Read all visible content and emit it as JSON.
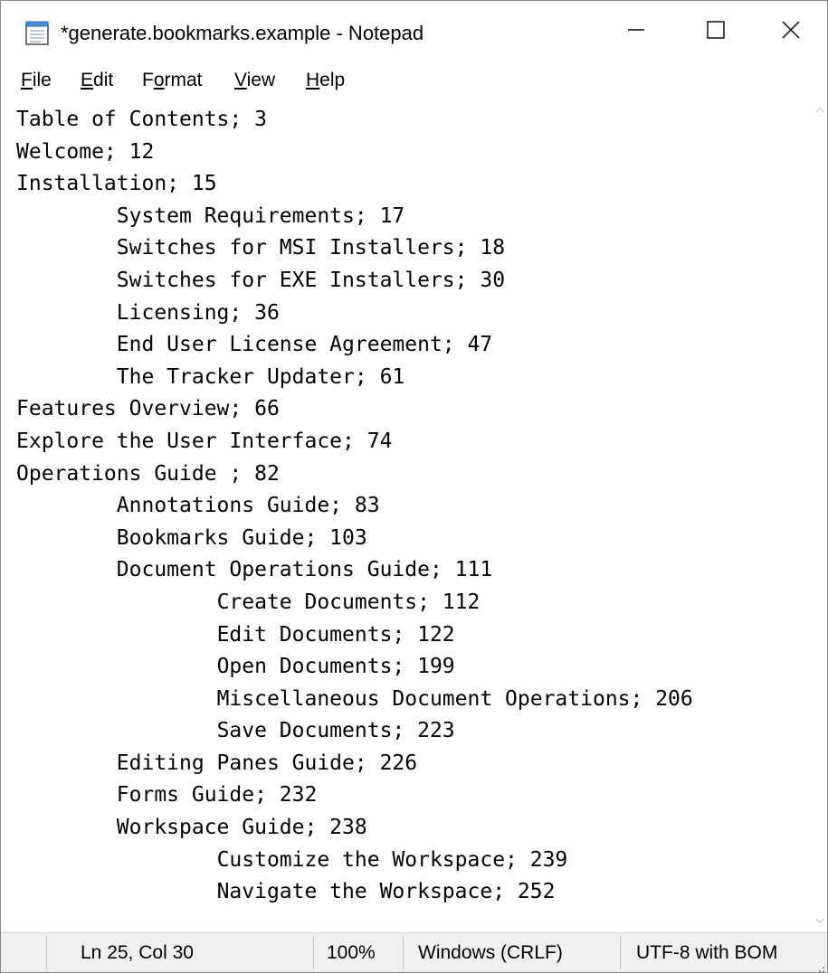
{
  "window": {
    "title": "*generate.bookmarks.example - Notepad"
  },
  "menu": {
    "items": [
      {
        "accel": "F",
        "rest": "ile"
      },
      {
        "accel": "E",
        "rest": "dit"
      },
      {
        "pre": "F",
        "accel": "o",
        "rest": "rmat"
      },
      {
        "accel": "V",
        "rest": "iew"
      },
      {
        "accel": "H",
        "rest": "elp"
      }
    ]
  },
  "editor": {
    "text": "Table of Contents; 3\nWelcome; 12\nInstallation; 15\n\tSystem Requirements; 17\n\tSwitches for MSI Installers; 18\n\tSwitches for EXE Installers; 30\n\tLicensing; 36\n\tEnd User License Agreement; 47\n\tThe Tracker Updater; 61\nFeatures Overview; 66\nExplore the User Interface; 74\nOperations Guide ; 82\n\tAnnotations Guide; 83\n\tBookmarks Guide; 103\n\tDocument Operations Guide; 111\n\t\tCreate Documents; 112\n\t\tEdit Documents; 122\n\t\tOpen Documents; 199\n\t\tMiscellaneous Document Operations; 206\n\t\tSave Documents; 223\n\tEditing Panes Guide; 226\n\tForms Guide; 232\n\tWorkspace Guide; 238\n\t\tCustomize the Workspace; 239\n\t\tNavigate the Workspace; 252"
  },
  "status": {
    "position": "Ln 25, Col 30",
    "zoom": "100%",
    "line_ending": "Windows (CRLF)",
    "encoding": "UTF-8 with BOM"
  },
  "colors": {
    "status_bg": "#f0f0f0",
    "icon_blue": "#3c8fd8"
  },
  "icons": {
    "app": "notepad-icon",
    "minimize": "minimize-icon",
    "maximize": "maximize-icon",
    "close": "close-icon"
  }
}
